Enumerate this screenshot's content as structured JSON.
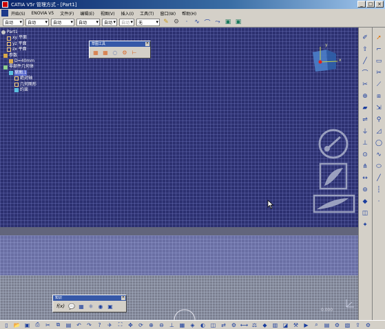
{
  "window": {
    "title": "CATIA V5r 管理方式 - [Part1]",
    "min_label": "_",
    "max_label": "□",
    "close_label": "×"
  },
  "menu": {
    "items": [
      "开始(S)",
      "ENOVIA V5",
      "文件(F)",
      "编辑(E)",
      "视图(V)",
      "插入(I)",
      "工具(T)",
      "窗口(W)",
      "帮助(H)"
    ]
  },
  "toolbar": {
    "selects": [
      "自动",
      "自动",
      "自动",
      "自动",
      "自动",
      "无"
    ],
    "disabled_select": "自动"
  },
  "tree": {
    "root": "Part1",
    "plane_xy": "xy 平面",
    "plane_yz": "yz 平面",
    "plane_zx": "zx 平面",
    "params": "参数",
    "param_item": "D=40mm",
    "body": "零部件几何体",
    "sketch": "草图.1",
    "axis": "绝对轴",
    "geometry": "几何图形",
    "constraints": "约束"
  },
  "sketch_tools": {
    "title": "草图工具",
    "close": "×"
  },
  "float_bar2": {
    "title": "知识",
    "close": "×",
    "fx_label": "f(x)"
  },
  "compass": {
    "x_label": "x",
    "y_label": "y"
  },
  "status": {
    "zoom": "0.000"
  },
  "icons": {
    "right_bar_outer": [
      "sketch-icon",
      "exit-workbench-icon",
      "line-icon",
      "arc-icon",
      "cut-icon",
      "constraint-icon",
      "pad-icon",
      "pocket-icon",
      "shaft-icon",
      "groove-icon",
      "hole-icon",
      "rib-icon",
      "slot-icon",
      "stiffener-icon",
      "loft-icon",
      "plane-icon",
      "point-icon",
      "axis-icon"
    ],
    "right_bar_inner": [
      "select-arrow-icon",
      "profile-icon",
      "rectangle-icon",
      "circle-icon",
      "spline-icon",
      "ellipse-icon",
      "line-2-icon",
      "axis-2-icon",
      "point-2-icon",
      "corner-icon",
      "chamfer-icon",
      "trim-icon",
      "mirror-icon",
      "project-icon",
      "intersect-icon"
    ]
  }
}
